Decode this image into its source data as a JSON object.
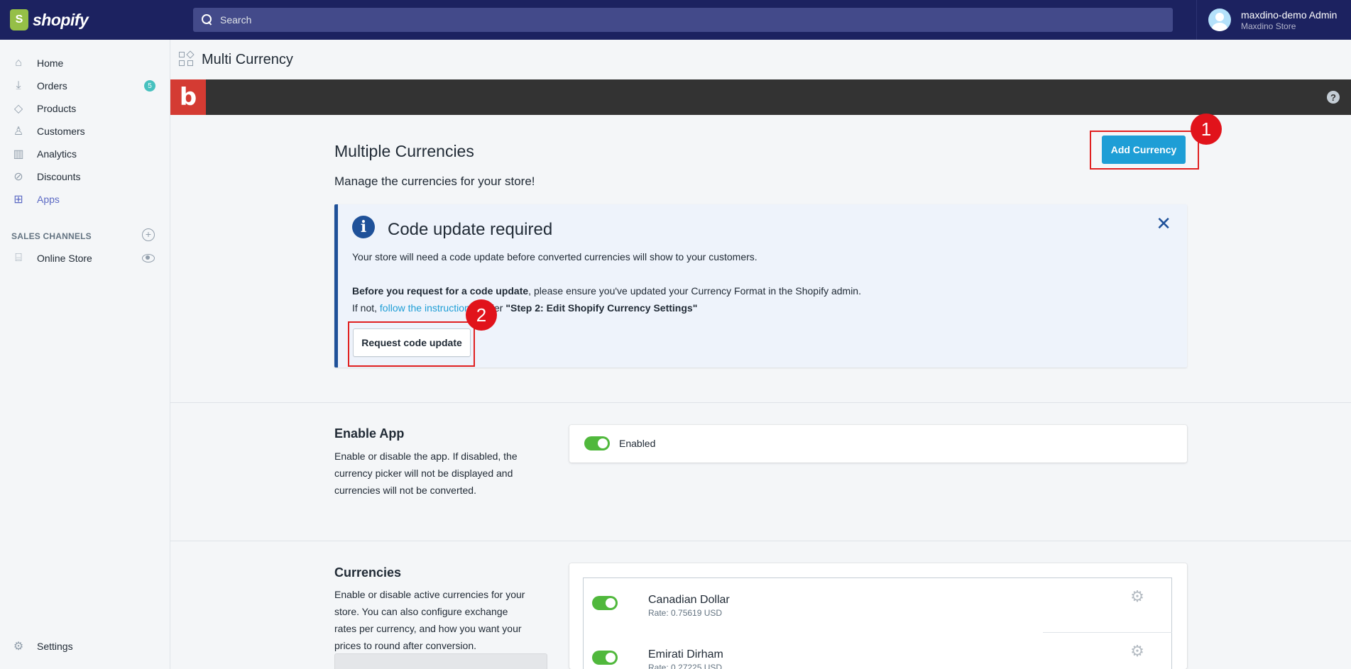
{
  "topbar": {
    "brand": "shopify",
    "search_placeholder": "Search",
    "user_name": "maxdino-demo Admin",
    "user_store": "Maxdino Store"
  },
  "sidebar": {
    "items": [
      {
        "label": "Home",
        "icon": "home-icon"
      },
      {
        "label": "Orders",
        "icon": "orders-icon",
        "badge": "5"
      },
      {
        "label": "Products",
        "icon": "tag-icon"
      },
      {
        "label": "Customers",
        "icon": "person-icon"
      },
      {
        "label": "Analytics",
        "icon": "bar-chart-icon"
      },
      {
        "label": "Discounts",
        "icon": "discount-icon"
      },
      {
        "label": "Apps",
        "icon": "apps-icon"
      }
    ],
    "sales_channels_title": "SALES CHANNELS",
    "online_store": "Online Store",
    "settings": "Settings"
  },
  "page": {
    "title": "Multi Currency"
  },
  "main": {
    "heading": "Multiple Currencies",
    "subheading": "Manage the currencies for your store!",
    "add_currency_button": "Add Currency",
    "callout_1": "1",
    "callout_2": "2",
    "notice": {
      "title": "Code update required",
      "line1": "Your store will need a code update before converted currencies will show to your customers.",
      "line2_bold": "Before you request for a code update",
      "line2_rest": ", please ensure you've updated your Currency Format in the Shopify admin.",
      "line3_prefix": "If not, ",
      "line3_link": "follow the instructions",
      "line3_middle": " under ",
      "line3_bold": "\"Step 2: Edit Shopify Currency Settings\"",
      "request_button": "Request code update"
    },
    "enable_app": {
      "heading": "Enable App",
      "description": "Enable or disable the app. If disabled, the currency picker will not be displayed and currencies will not be converted.",
      "toggle_label": "Enabled"
    },
    "currencies": {
      "heading": "Currencies",
      "description": "Enable or disable active currencies for your store. You can also configure exchange rates per currency, and how you want your prices to round after conversion.",
      "items": [
        {
          "name": "Canadian Dollar",
          "rate": "Rate: 0.75619 USD"
        },
        {
          "name": "Emirati Dirham",
          "rate": "Rate: 0.27225 USD"
        }
      ]
    }
  },
  "colors": {
    "topbar": "#1c2260",
    "primary_button": "#1e9ed6",
    "toggle_on": "#50b83c",
    "notice_accent": "#1f5199",
    "callout_red": "#e1131b"
  }
}
